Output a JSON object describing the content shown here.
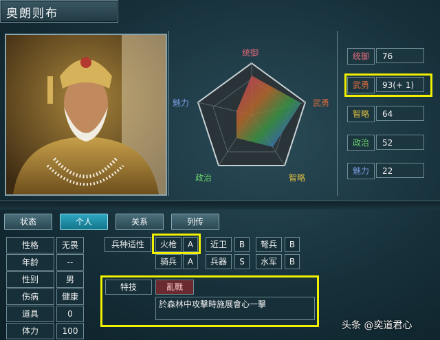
{
  "character": {
    "name": "奥朗则布"
  },
  "radar": {
    "labels": {
      "top": "统御",
      "right": "武勇",
      "bottom_right": "智略",
      "bottom_left": "政治",
      "left": "魅力"
    }
  },
  "stats": [
    {
      "label": "统御",
      "value": "76"
    },
    {
      "label": "武勇",
      "value": "93(+ 1)"
    },
    {
      "label": "智略",
      "value": "64"
    },
    {
      "label": "政治",
      "value": "52"
    },
    {
      "label": "魅力",
      "value": "22"
    }
  ],
  "tabs": [
    {
      "label": "状态",
      "active": false
    },
    {
      "label": "个人",
      "active": true
    },
    {
      "label": "关系",
      "active": false
    },
    {
      "label": "列传",
      "active": false
    }
  ],
  "personal": [
    {
      "label": "性格",
      "value": "无畏"
    },
    {
      "label": "年龄",
      "value": "--"
    },
    {
      "label": "性别",
      "value": "男"
    },
    {
      "label": "伤病",
      "value": "健康"
    },
    {
      "label": "道具",
      "value": "0"
    },
    {
      "label": "体力",
      "value": "100"
    }
  ],
  "aptitude": {
    "header": "兵种适性",
    "row1": [
      {
        "unit": "火枪",
        "grade": "A"
      },
      {
        "unit": "近卫",
        "grade": "B"
      },
      {
        "unit": "弩兵",
        "grade": "B"
      }
    ],
    "row2": [
      {
        "unit": "骑兵",
        "grade": "A"
      },
      {
        "unit": "兵器",
        "grade": "S"
      },
      {
        "unit": "水军",
        "grade": "B"
      }
    ]
  },
  "skill": {
    "header": "特技",
    "name": "亂戰",
    "description": "於森林中攻擊時施展會心一擊"
  },
  "watermark": "头条 @奕道君心",
  "colors": {
    "highlight": "#f0f000",
    "active_tab": "#1a8fa8",
    "panel_border": "#6d8a95"
  }
}
